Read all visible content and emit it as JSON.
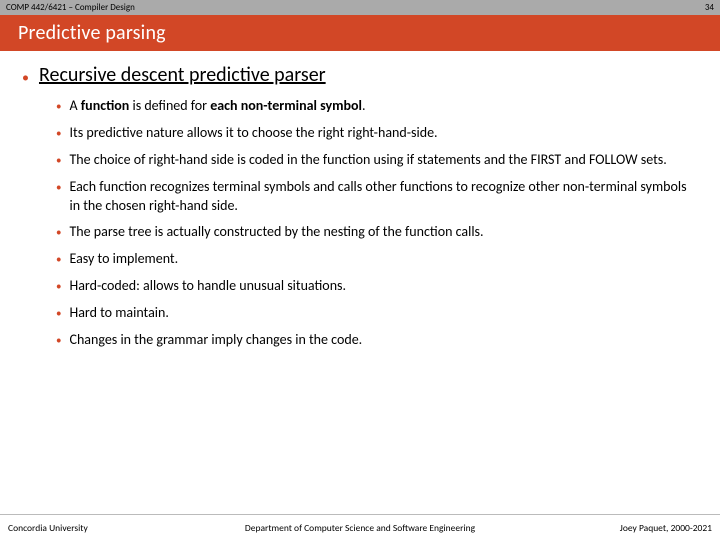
{
  "header": {
    "course": "COMP 442/6421 – Compiler Design",
    "page_number": "34"
  },
  "title": "Predictive parsing",
  "heading": "Recursive descent predictive parser",
  "points": [
    {
      "prefix": "A ",
      "bold1": "function",
      "mid": " is defined for ",
      "bold2": "each non-terminal symbol",
      "suffix": "."
    },
    {
      "text": "Its predictive nature allows it to choose the right right-hand-side."
    },
    {
      "text": "The choice of right-hand side is coded in the function using if statements and the FIRST and FOLLOW sets."
    },
    {
      "text": "Each function recognizes terminal symbols and calls other functions to recognize other non-terminal symbols in the chosen right-hand side."
    },
    {
      "text": "The parse tree is actually constructed by the nesting of the function calls."
    },
    {
      "text": "Easy to implement."
    },
    {
      "text": "Hard-coded: allows to handle unusual situations."
    },
    {
      "text": "Hard to maintain."
    },
    {
      "text": "Changes in the grammar imply changes in the code."
    }
  ],
  "footer": {
    "left": "Concordia University",
    "center": "Department of Computer Science and Software Engineering",
    "right": "Joey Paquet, 2000-2021"
  }
}
